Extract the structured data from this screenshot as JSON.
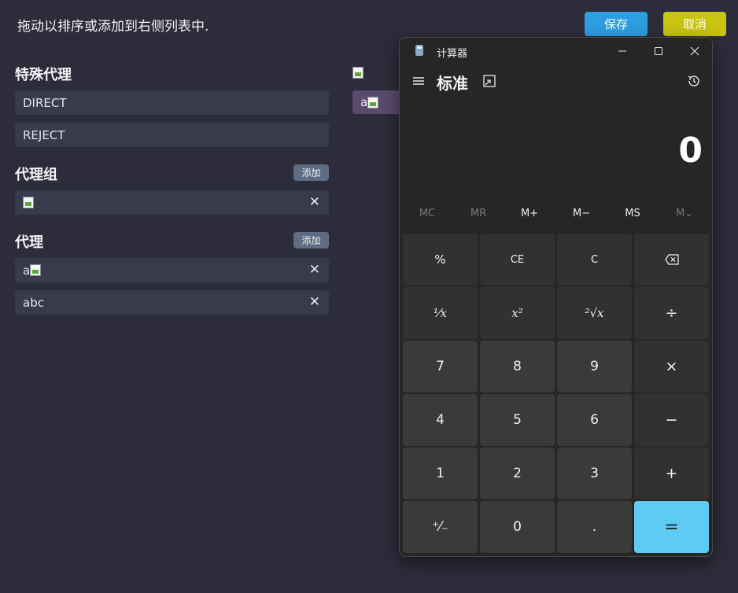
{
  "editor": {
    "instruction": "拖动以排序或添加到右侧列表中.",
    "save_label": "保存",
    "cancel_label": "取消",
    "sections": {
      "special": {
        "title": "特殊代理",
        "items": [
          "DIRECT",
          "REJECT"
        ]
      },
      "group": {
        "title": "代理组",
        "add_label": "添加"
      },
      "proxy": {
        "title": "代理",
        "add_label": "添加",
        "items": [
          "a",
          "abc"
        ]
      }
    },
    "right_list": {
      "items": [
        "a"
      ]
    },
    "close_glyph": "✕"
  },
  "calculator": {
    "window_title": "计算器",
    "mode": "标准",
    "display": "0",
    "memory": [
      {
        "label": "MC",
        "enabled": false
      },
      {
        "label": "MR",
        "enabled": false
      },
      {
        "label": "M+",
        "enabled": true
      },
      {
        "label": "M−",
        "enabled": true
      },
      {
        "label": "MS",
        "enabled": true
      },
      {
        "label": "M⌄",
        "enabled": false
      }
    ],
    "keys": {
      "percent": "%",
      "ce": "CE",
      "c": "C",
      "backspace": "⌫",
      "reciprocal": "¹⁄x",
      "square": "x²",
      "sqrt": "²√x",
      "divide": "÷",
      "seven": "7",
      "eight": "8",
      "nine": "9",
      "multiply": "×",
      "four": "4",
      "five": "5",
      "six": "6",
      "minus": "−",
      "one": "1",
      "two": "2",
      "three": "3",
      "plus": "+",
      "negate": "⁺⁄₋",
      "zero": "0",
      "decimal": ".",
      "equals": "="
    },
    "colors": {
      "accent": "#5fcbf5",
      "window_bg": "#272625"
    }
  }
}
